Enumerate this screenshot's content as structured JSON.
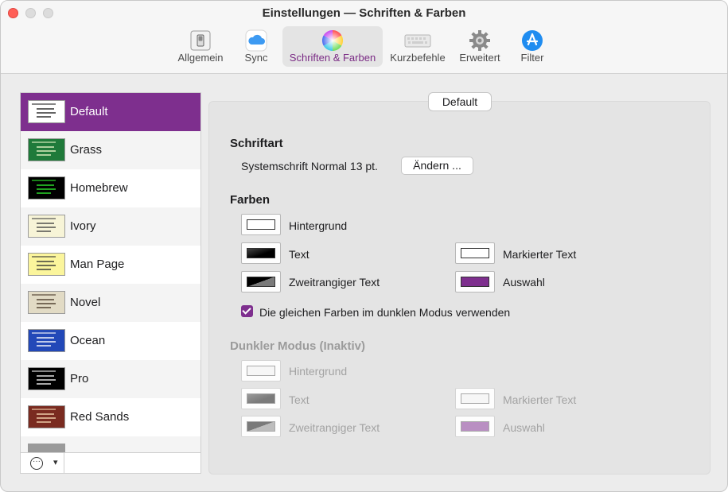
{
  "window": {
    "title": "Einstellungen — Schriften & Farben"
  },
  "toolbar": {
    "items": [
      {
        "label": "Allgemein",
        "icon": "switch-icon"
      },
      {
        "label": "Sync",
        "icon": "cloud-icon"
      },
      {
        "label": "Schriften & Farben",
        "icon": "color-wheel-icon",
        "active": true
      },
      {
        "label": "Kurzbefehle",
        "icon": "keyboard-icon"
      },
      {
        "label": "Erweitert",
        "icon": "gear-icon"
      },
      {
        "label": "Filter",
        "icon": "app-store-icon"
      }
    ]
  },
  "themes": [
    {
      "name": "Default",
      "selected": true,
      "bg": "#ffffff",
      "fg": "#222222"
    },
    {
      "name": "Grass",
      "bg": "#1f7a3a",
      "fg": "#e8f5c8"
    },
    {
      "name": "Homebrew",
      "bg": "#000000",
      "fg": "#2ee82e"
    },
    {
      "name": "Ivory",
      "bg": "#f7f4d7",
      "fg": "#444444"
    },
    {
      "name": "Man Page",
      "bg": "#fbf59c",
      "fg": "#333333"
    },
    {
      "name": "Novel",
      "bg": "#e2dbc5",
      "fg": "#4a3a2a"
    },
    {
      "name": "Ocean",
      "bg": "#2248b8",
      "fg": "#ffffff"
    },
    {
      "name": "Pro",
      "bg": "#000000",
      "fg": "#f0f0f0"
    },
    {
      "name": "Red Sands",
      "bg": "#7a2b20",
      "fg": "#f5d6b0"
    }
  ],
  "preset_badge": "Default",
  "font_section": {
    "heading": "Schriftart",
    "current_font": "Systemschrift Normal 13 pt.",
    "change_button": "Ändern ..."
  },
  "colors_section": {
    "heading": "Farben",
    "background_label": "Hintergrund",
    "text_label": "Text",
    "secondary_text_label": "Zweitrangiger Text",
    "marked_text_label": "Markierter Text",
    "selection_label": "Auswahl",
    "selection_color": "#7e2f8e",
    "same_colors_checkbox": "Die gleichen Farben im dunklen Modus verwenden",
    "same_colors_checked": true
  },
  "dark_section": {
    "heading": "Dunkler Modus (Inaktiv)",
    "background_label": "Hintergrund",
    "text_label": "Text",
    "secondary_text_label": "Zweitrangiger Text",
    "marked_text_label": "Markierter Text",
    "selection_label": "Auswahl",
    "selection_color": "#b98fc2"
  },
  "accent_color": "#7e2f8e"
}
